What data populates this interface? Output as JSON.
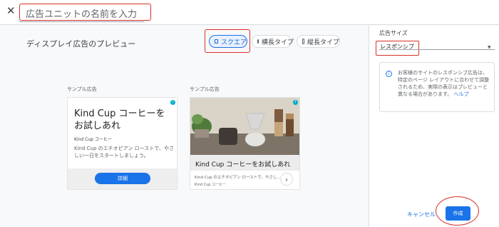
{
  "header": {
    "close_icon": "close-icon",
    "ad_unit_name_placeholder": "広告ユニットの名前を入力"
  },
  "preview": {
    "title": "ディスプレイ広告のプレビュー",
    "shape_chips": [
      {
        "label": "スクエア",
        "selected": true
      },
      {
        "label": "横長タイプ",
        "selected": false
      },
      {
        "label": "縦長タイプ",
        "selected": false
      }
    ],
    "sample_label_1": "サンプル広告",
    "sample_label_2": "サンプル広告",
    "ad1": {
      "title": "Kind Cup コーヒーをお試しあれ",
      "brand": "Kind Cup コーヒー",
      "description": "Kind Cup のエチオピアン ローストで、やさしい一日をスタートしましょう。",
      "button": "詳細"
    },
    "ad2": {
      "title": "Kind Cup コーヒーをお試しあれ",
      "description": "Kind Cup のエチオピアン ローストで、やさし...",
      "brand": "Kind Cup コーヒー",
      "arrow": "›"
    }
  },
  "side": {
    "size_label": "広告サイズ",
    "size_value": "レスポンシブ",
    "info_text": "お客様のサイトのレスポンシブ広告は、特定のページ レイアウトに合わせて調整されるため、実際の表示はプレビューと異なる場合があります。",
    "info_link": "ヘルプ",
    "cancel": "キャンセル",
    "create": "作成"
  },
  "colors": {
    "accent": "#1a73e8",
    "highlight": "#d93025"
  }
}
